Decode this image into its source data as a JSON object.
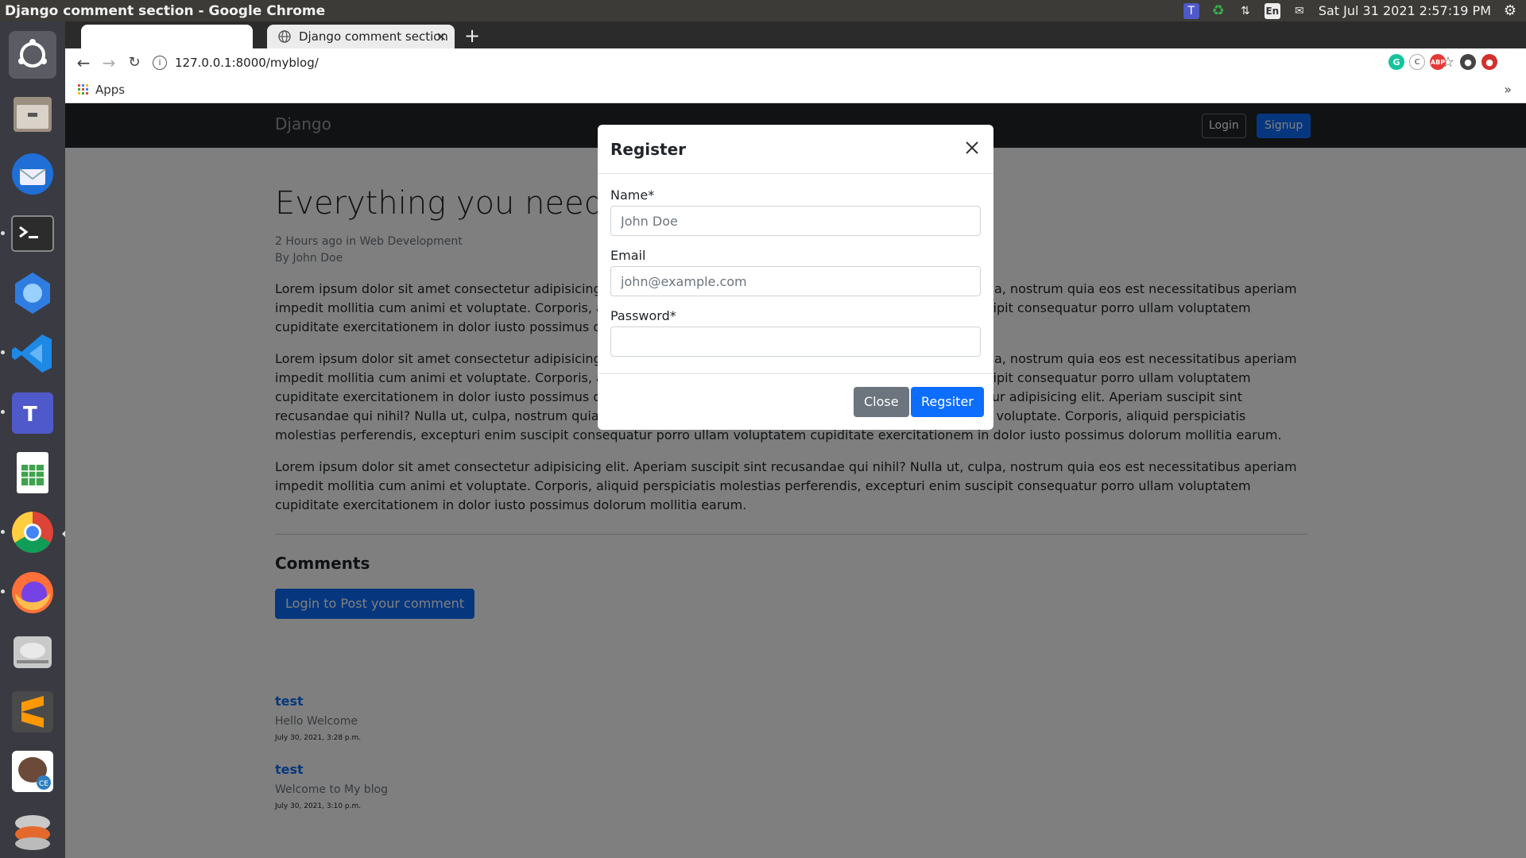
{
  "window": {
    "title": "Django comment section - Google Chrome"
  },
  "system_tray": {
    "keyboard_layout": "En",
    "datetime": "Sat Jul 31 2021  2:57:19 PM"
  },
  "launcher": {
    "apps": [
      "ubuntu-dash",
      "files",
      "thunderbird",
      "terminal",
      "wps-office",
      "vscode",
      "teams",
      "spreadsheet",
      "chrome",
      "firefox",
      "disks",
      "sublime-text",
      "pgadmin",
      "unity"
    ]
  },
  "browser": {
    "tabs": [
      {
        "label": ""
      },
      {
        "label": "Django comment section"
      }
    ],
    "new_tab": "+",
    "url": "127.0.0.1:8000/myblog/",
    "bookmarks": {
      "apps_label": "Apps",
      "more": "»"
    }
  },
  "page": {
    "navbar": {
      "brand": "Django",
      "login": "Login",
      "signup": "Signup"
    },
    "post": {
      "title": "Everything you need to",
      "meta_line1": "2 Hours ago in Web Development",
      "meta_line2": "By John Doe",
      "paragraphs": [
        "Lorem ipsum dolor sit amet consectetur adipisicing elit. Aperiam suscipit sint recusandae qui nihil? Nulla ut, culpa, nostrum quia eos est necessitatibus aperiam impedit mollitia cum animi et voluptate. Corporis, aliquid perspiciatis molestias perferendis, excepturi enim suscipit consequatur porro ullam voluptatem cupiditate exercitationem in dolor iusto possimus dolorum mollitia earum.",
        "Lorem ipsum dolor sit amet consectetur adipisicing elit. Aperiam suscipit sint recusandae qui nihil? Nulla ut, culpa, nostrum quia eos est necessitatibus aperiam impedit mollitia cum animi et voluptate. Corporis, aliquid perspiciatis molestias perferendis, excepturi enim suscipit consequatur porro ullam voluptatem cupiditate exercitationem in dolor iusto possimus dolorum mollitia earum. Lorem ipsum dolor sit amet consectetur adipisicing elit. Aperiam suscipit sint recusandae qui nihil? Nulla ut, culpa, nostrum quia eos est necessitatibus aperiam impedit mollitia cum animi et voluptate. Corporis, aliquid perspiciatis molestias perferendis, excepturi enim suscipit consequatur porro ullam voluptatem cupiditate exercitationem in dolor iusto possimus dolorum mollitia earum.",
        "Lorem ipsum dolor sit amet consectetur adipisicing elit. Aperiam suscipit sint recusandae qui nihil? Nulla ut, culpa, nostrum quia eos est necessitatibus aperiam impedit mollitia cum animi et voluptate. Corporis, aliquid perspiciatis molestias perferendis, excepturi enim suscipit consequatur porro ullam voluptatem cupiditate exercitationem in dolor iusto possimus dolorum mollitia earum."
      ]
    },
    "comments": {
      "heading": "Comments",
      "post_button": "Login to Post your comment",
      "items": [
        {
          "author": "test",
          "text": "Hello Welcome",
          "date": "July 30, 2021, 3:28 p.m."
        },
        {
          "author": "test",
          "text": "Welcome to My blog",
          "date": "July 30, 2021, 3:10 p.m."
        }
      ]
    }
  },
  "modal": {
    "title": "Register",
    "fields": {
      "name": {
        "label": "Name*",
        "placeholder": "John Doe"
      },
      "email": {
        "label": "Email",
        "placeholder": "john@example.com"
      },
      "password": {
        "label": "Password*",
        "placeholder": ""
      }
    },
    "close_button": "Close",
    "register_button": "Regsiter"
  },
  "colors": {
    "primary": "#0d6efd",
    "secondary": "#6c757d",
    "navbar": "#212529"
  }
}
